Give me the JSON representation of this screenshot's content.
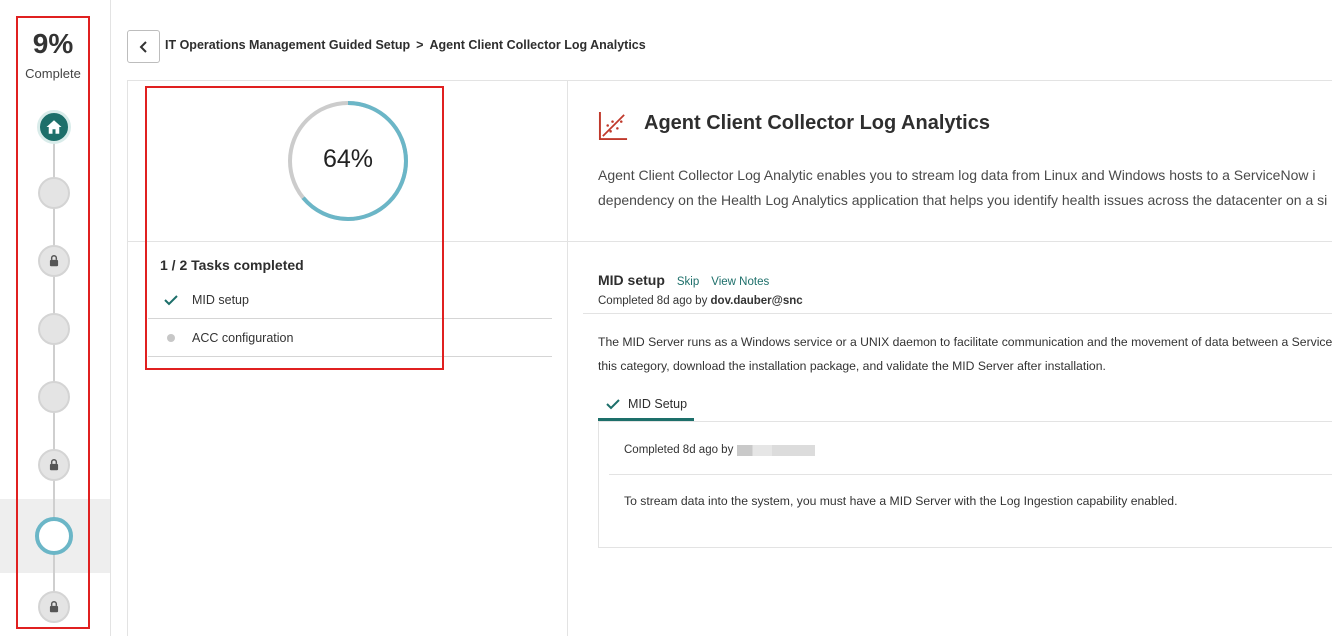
{
  "rail": {
    "percent": "9%",
    "label": "Complete",
    "progress_fraction": 0.09,
    "steps": [
      {
        "state": "home",
        "icon": "home-icon"
      },
      {
        "state": "not-started"
      },
      {
        "state": "locked",
        "icon": "lock-icon"
      },
      {
        "state": "not-started"
      },
      {
        "state": "not-started"
      },
      {
        "state": "locked",
        "icon": "lock-icon"
      },
      {
        "state": "current"
      },
      {
        "state": "locked",
        "icon": "lock-icon"
      }
    ]
  },
  "breadcrumb": {
    "parent": "IT Operations Management Guided Setup",
    "separator": ">",
    "current": "Agent Client Collector Log Analytics"
  },
  "progress": {
    "percent_label": "64%",
    "fraction": 0.64,
    "tasks_title": "1 / 2 Tasks completed",
    "tasks": [
      {
        "label": "MID setup",
        "done": true
      },
      {
        "label": "ACC configuration",
        "done": false
      }
    ]
  },
  "detail": {
    "title": "Agent Client Collector Log Analytics",
    "description_line1": "Agent Client Collector Log Analytic enables you to stream log data from Linux and Windows hosts to a ServiceNow i",
    "description_line2": "dependency on the Health Log Analytics application that helps you identify health issues across the datacenter on a si"
  },
  "section": {
    "title": "MID setup",
    "skip_label": "Skip",
    "view_notes_label": "View Notes",
    "meta_prefix": "Completed 8d ago by",
    "meta_user": "dov.dauber@snc",
    "body_line1": "The MID Server runs as a Windows service or a UNIX daemon to facilitate communication and the movement of data between a ServiceN",
    "body_line2": "this category, download the installation package, and validate the MID Server after installation."
  },
  "tab": {
    "label": "MID Setup"
  },
  "card": {
    "meta_prefix": "Completed 8d ago by",
    "body": "To stream data into the system, you must have a MID Server with the Log Ingestion capability enabled."
  },
  "colors": {
    "accent": "#1d6f6a",
    "ring": "#6bb6c7",
    "ring_track": "#cccccc",
    "annotation": "#e02020",
    "icon_red": "#c0392b"
  }
}
